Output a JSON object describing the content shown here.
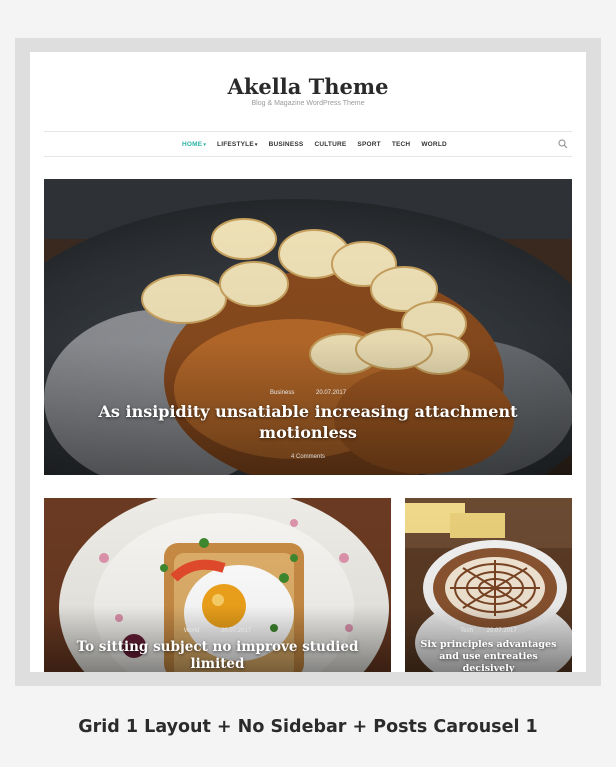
{
  "site": {
    "title": "Akella Theme",
    "tagline": "Blog & Magazine WordPress Theme"
  },
  "nav": {
    "items": [
      {
        "label": "HOME",
        "active": true,
        "has_dropdown": true
      },
      {
        "label": "LIFESTYLE",
        "active": false,
        "has_dropdown": true
      },
      {
        "label": "BUSINESS",
        "active": false,
        "has_dropdown": false
      },
      {
        "label": "CULTURE",
        "active": false,
        "has_dropdown": false
      },
      {
        "label": "SPORT",
        "active": false,
        "has_dropdown": false
      },
      {
        "label": "TECH",
        "active": false,
        "has_dropdown": false
      },
      {
        "label": "WORLD",
        "active": false,
        "has_dropdown": false
      }
    ],
    "search_icon": "search-icon",
    "active_color": "#2bb3a4"
  },
  "featured": {
    "category": "Business",
    "date": "20.07.2017",
    "title": "As insipidity unsatiable increasing attachment motionless",
    "comments": "4 Comments"
  },
  "grid": [
    {
      "category": "World",
      "date": "20.07.2017",
      "title": "To sitting subject no improve studied limited"
    },
    {
      "category": "Tech",
      "date": "20.07.2017",
      "title": "Six principles advantages and use entreaties decisively"
    }
  ],
  "caption": "Grid 1 Layout + No Sidebar + Posts Carousel 1"
}
